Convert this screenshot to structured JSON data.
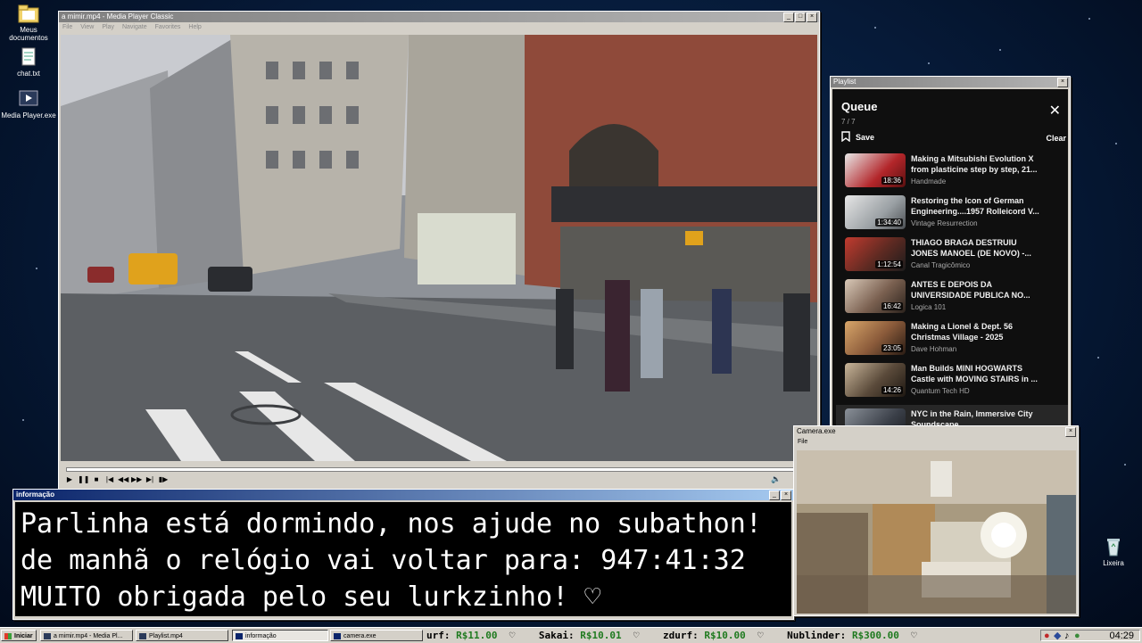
{
  "desktop": {
    "icons": [
      {
        "label": "Meus documentos",
        "icon": "folder-icon"
      },
      {
        "label": "chat.txt",
        "icon": "text-file-icon"
      },
      {
        "label": "Media Player.exe",
        "icon": "media-player-icon"
      },
      {
        "label": "Lixeira",
        "icon": "recycle-bin-icon"
      }
    ]
  },
  "media_player": {
    "title": "a mimir.mp4 - Media Player Classic",
    "menu": [
      "File",
      "View",
      "Play",
      "Navigate",
      "Favorites",
      "Help"
    ],
    "progress": 0.002,
    "controls": [
      "play",
      "pause",
      "stop",
      "prev",
      "rewind",
      "forward",
      "next",
      "frame-step"
    ]
  },
  "playlist": {
    "window_title": "Playlist",
    "heading": "Queue",
    "count": "7 / 7",
    "save_label": "Save",
    "clear_label": "Clear",
    "items": [
      {
        "title": "Making a Mitsubishi Evolution X from plasticine step by step, 21...",
        "channel": "Handmade",
        "duration": "18:36",
        "color": "#b3262a"
      },
      {
        "title": "Restoring the Icon of German Engineering....1957 Rolleicord V...",
        "channel": "Vintage Resurrection",
        "duration": "1:34:40",
        "color": "#9aa0a4"
      },
      {
        "title": "THIAGO BRAGA DESTRUIU JONES MANOEL (DE NOVO) -...",
        "channel": "Canal Tragicômico",
        "duration": "1:12:54",
        "color": "#5e2a22"
      },
      {
        "title": "ANTES E DEPOIS DA UNIVERSIDADE PUBLICA NO...",
        "channel": "Logica 101",
        "duration": "16:42",
        "color": "#7a6050"
      },
      {
        "title": "Making a Lionel & Dept. 56 Christmas Village - 2025",
        "channel": "Dave Hohman",
        "duration": "23:05",
        "color": "#8a5a3a"
      },
      {
        "title": "Man Builds MINI HOGWARTS Castle with MOVING STAIRS in ...",
        "channel": "Quantum Tech HD",
        "duration": "14:26",
        "color": "#5a4a3a"
      },
      {
        "title": "NYC in the Rain, Immersive City Soundscape",
        "channel": "",
        "duration": "",
        "color": "#3a3f48"
      }
    ]
  },
  "info_window": {
    "title": "informação",
    "lines": [
      "Parlinha está dormindo, nos ajude no subathon!",
      "de manhã o relógio vai voltar para:  947:41:32",
      "MUITO obrigada pelo seu lurkzinho! ♡"
    ]
  },
  "camera": {
    "title": "Camera.exe",
    "menu": "File"
  },
  "taskbar": {
    "start_label": "Iniciar",
    "items": [
      "a mimir.mp4 - Media Pl...",
      "Playlist.mp4",
      "informação",
      "camera.exe"
    ],
    "ticker": [
      {
        "name": "urf:",
        "amount": "R$11.00"
      },
      {
        "name": "Sakai:",
        "amount": "R$10.01"
      },
      {
        "name": "zdurf:",
        "amount": "R$10.00"
      },
      {
        "name": "Nublinder:",
        "amount": "R$300.00"
      }
    ],
    "clock": "04:29"
  }
}
